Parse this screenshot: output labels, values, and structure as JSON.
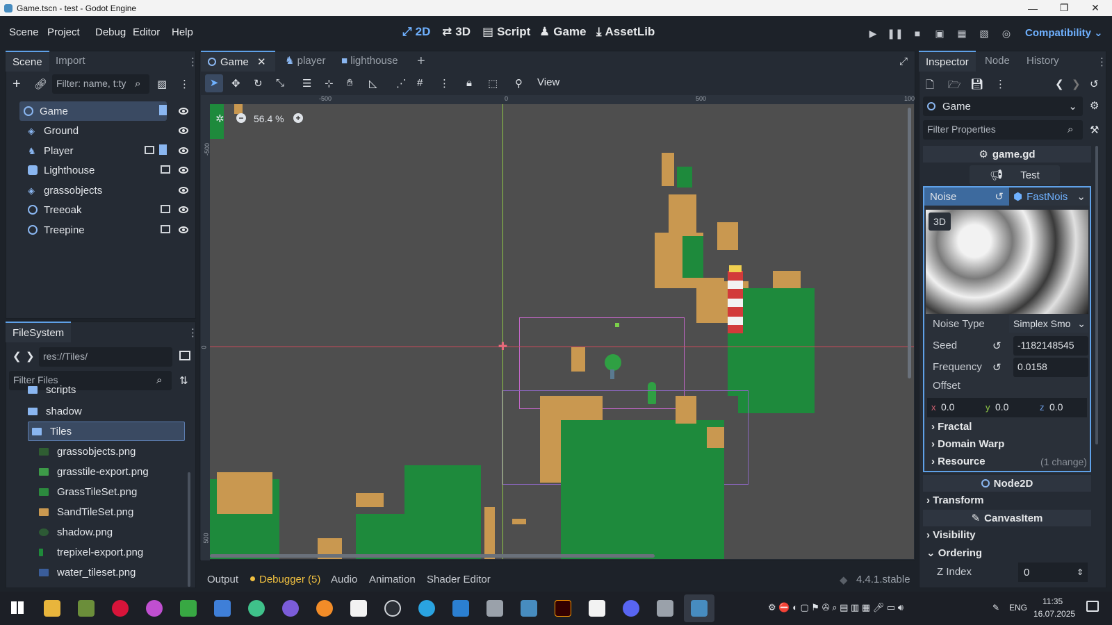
{
  "window": {
    "title": "Game.tscn - test - Godot Engine"
  },
  "menu": [
    "Scene",
    "Project",
    "Debug",
    "Editor",
    "Help"
  ],
  "workspaces": [
    "2D",
    "3D",
    "Script",
    "Game",
    "AssetLib"
  ],
  "renderer": "Compatibility",
  "scene_dock": {
    "tabs": [
      "Scene",
      "Import"
    ],
    "filter_placeholder": "Filter: name, t:ty",
    "nodes": [
      {
        "name": "Game",
        "type": "node2d"
      },
      {
        "name": "Ground",
        "type": "tilemap"
      },
      {
        "name": "Player",
        "type": "character"
      },
      {
        "name": "Lighthouse",
        "type": "sprite"
      },
      {
        "name": "grassobjects",
        "type": "tilemap"
      },
      {
        "name": "Treeoak",
        "type": "node2d"
      },
      {
        "name": "Treepine",
        "type": "node2d"
      }
    ]
  },
  "filesystem": {
    "title": "FileSystem",
    "path": "res://Tiles/",
    "filter_placeholder": "Filter Files",
    "items": [
      {
        "name": "scripts",
        "kind": "folder"
      },
      {
        "name": "shadow",
        "kind": "folder"
      },
      {
        "name": "Tiles",
        "kind": "folder"
      },
      {
        "name": "grassobjects.png",
        "kind": "file"
      },
      {
        "name": "grasstile-export.png",
        "kind": "file"
      },
      {
        "name": "GrassTileSet.png",
        "kind": "file"
      },
      {
        "name": "SandTileSet.png",
        "kind": "file"
      },
      {
        "name": "shadow.png",
        "kind": "file"
      },
      {
        "name": "trepixel-export.png",
        "kind": "file"
      },
      {
        "name": "water_tileset.png",
        "kind": "file"
      }
    ]
  },
  "editor_tabs": [
    "Game",
    "player",
    "lighthouse"
  ],
  "viewport": {
    "zoom": "56.4 %",
    "view_menu": "View",
    "ruler_top": [
      "-500",
      "0",
      "500",
      "100"
    ],
    "ruler_left": [
      "-500",
      "0",
      "500"
    ]
  },
  "inspector": {
    "tabs": [
      "Inspector",
      "Node",
      "History"
    ],
    "object": "Game",
    "filter_placeholder": "Filter Properties",
    "script": "game.gd",
    "test_button": "Test",
    "noise_label": "Noise",
    "noise_value": "FastNois",
    "badge_3d": "3D",
    "noise_type_label": "Noise Type",
    "noise_type_value": "Simplex Smo",
    "seed_label": "Seed",
    "seed_value": "-1182148545",
    "frequency_label": "Frequency",
    "frequency_value": "0.0158",
    "offset_label": "Offset",
    "offset_x": "0.0",
    "offset_y": "0.0",
    "offset_z": "0.0",
    "fractal": "Fractal",
    "domain_warp": "Domain Warp",
    "resource": "Resource",
    "resource_note": "(1 change)",
    "node2d": "Node2D",
    "transform": "Transform",
    "canvasitem": "CanvasItem",
    "visibility": "Visibility",
    "ordering": "Ordering",
    "zindex_label": "Z Index",
    "zindex_value": "0"
  },
  "bottom_panel": {
    "tabs": [
      "Output",
      "Debugger (5)",
      "Audio",
      "Animation",
      "Shader Editor"
    ],
    "version": "4.4.1.stable"
  },
  "taskbar": {
    "lang": "ENG",
    "time": "11:35",
    "date": "16.07.2025"
  },
  "colors": {
    "accent": "#6fb1ff",
    "panel": "#252b34",
    "grass": "#1e8a3c",
    "sand": "#c99850",
    "canvas": "#4e4e4e"
  }
}
